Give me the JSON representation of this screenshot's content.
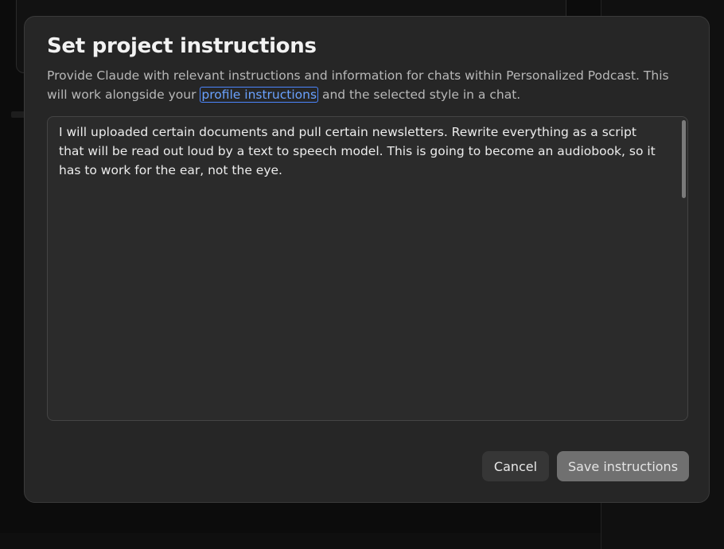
{
  "modal": {
    "title": "Set project instructions",
    "description_before": "Provide Claude with relevant instructions and information for chats within Personalized Podcast. This will work alongside your ",
    "link_label": "profile instructions",
    "description_after": " and the selected style in a chat.",
    "instructions_value": "I will uploaded certain documents and pull certain newsletters. Rewrite everything as a script that will be read out loud by a text to speech model. This is going to become an audiobook, so it has to work for the ear, not the eye.",
    "cancel_label": "Cancel",
    "save_label": "Save instructions"
  },
  "colors": {
    "link": "#6aa2ff",
    "modal_bg": "#262626",
    "save_button_bg": "#707070"
  }
}
